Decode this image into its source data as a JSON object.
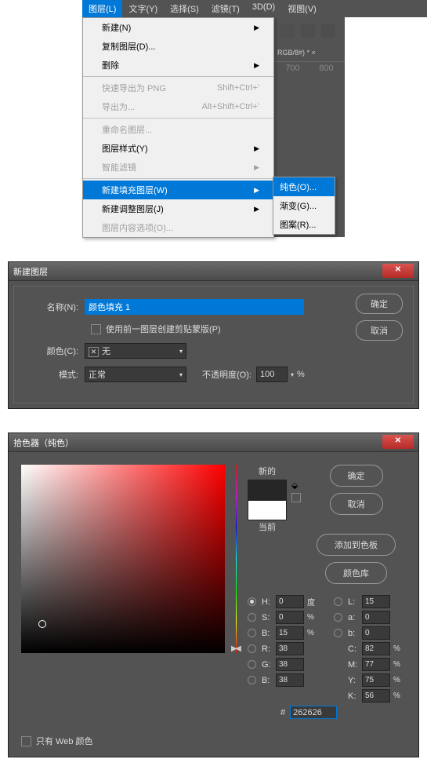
{
  "menu": {
    "items": [
      "图层(L)",
      "文字(Y)",
      "选择(S)",
      "滤镜(T)",
      "3D(D)",
      "视图(V)"
    ],
    "dropdown": [
      {
        "label": "新建(N)",
        "arrow": true
      },
      {
        "label": "复制图层(D)..."
      },
      {
        "label": "删除",
        "arrow": true
      },
      {
        "sep": true
      },
      {
        "label": "快速导出为 PNG",
        "shortcut": "Shift+Ctrl+'",
        "disabled": true
      },
      {
        "label": "导出为...",
        "shortcut": "Alt+Shift+Ctrl+'",
        "disabled": true
      },
      {
        "sep": true
      },
      {
        "label": "重命名图层...",
        "disabled": true
      },
      {
        "label": "图层样式(Y)",
        "arrow": true
      },
      {
        "label": "智能滤镜",
        "arrow": true,
        "disabled": true
      },
      {
        "sep": true
      },
      {
        "label": "新建填充图层(W)",
        "arrow": true,
        "hl": true
      },
      {
        "label": "新建调整图层(J)",
        "arrow": true
      },
      {
        "label": "图层内容选项(O)...",
        "disabled": true
      }
    ],
    "submenu": [
      "纯色(O)...",
      "渐变(G)...",
      "图案(R)..."
    ],
    "doctab": "RGB/8#) * ×",
    "ruler": [
      "700",
      "800"
    ]
  },
  "newlayer": {
    "title": "新建图层",
    "name_label": "名称(N):",
    "name_value": "颜色填充 1",
    "clipmask": "使用前一图层创建剪贴蒙版(P)",
    "color_label": "颜色(C):",
    "color_value": "无",
    "mode_label": "模式:",
    "mode_value": "正常",
    "opacity_label": "不透明度(O):",
    "opacity_value": "100",
    "pct": "%",
    "ok": "确定",
    "cancel": "取消"
  },
  "picker": {
    "title": "拾色器（纯色）",
    "new": "新的",
    "current": "当前",
    "ok": "确定",
    "cancel": "取消",
    "addswatch": "添加到色板",
    "colorlib": "颜色库",
    "websafe": "只有 Web 颜色",
    "hex": "#",
    "hexval": "262626",
    "vals": {
      "H": "0",
      "H_u": "度",
      "S": "0",
      "S_u": "%",
      "Bhsb": "15",
      "Bhsb_u": "%",
      "L": "15",
      "a": "0",
      "b": "0",
      "R": "38",
      "G": "38",
      "Brgb": "38",
      "C": "82",
      "M": "77",
      "Y": "75",
      "K": "56",
      "cmyk_u": "%"
    }
  }
}
